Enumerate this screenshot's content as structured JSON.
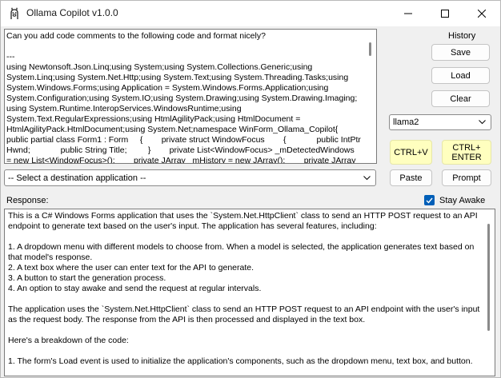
{
  "window": {
    "title": "Ollama Copilot v1.0.0",
    "icon": "llama-icon",
    "controls": {
      "minimize": "minimize-icon",
      "maximize": "maximize-icon",
      "close": "close-icon"
    }
  },
  "prompt": {
    "lines": [
      "Can you add code comments to the following code and format nicely?",
      "",
      "---",
      "using Newtonsoft.Json.Linq;using System;using System.Collections.Generic;using",
      "System.Linq;using System.Net.Http;using System.Text;using System.Threading.Tasks;using",
      "System.Windows.Forms;using Application = System.Windows.Forms.Application;using",
      "System.Configuration;using System.IO;using System.Drawing;using System.Drawing.Imaging;",
      "using System.Runtime.InteropServices.WindowsRuntime;using",
      "System.Text.RegularExpressions;using HtmlAgilityPack;using HtmlDocument =",
      "HtmlAgilityPack.HtmlDocument;using System.Net;namespace WinForm_Ollama_Copilot{",
      "public partial class Form1 : Form     {        private struct WindowFocus        {             public IntPtr",
      "Hwnd;             public String Title;         }        private List<WindowFocus> _mDetectedWindows",
      "= new List<WindowFocus>();        private JArray _mHistory = new JArray();        private JArray"
    ]
  },
  "sidebar": {
    "history_label": "History",
    "save_label": "Save",
    "load_label": "Load",
    "clear_label": "Clear",
    "model_selected": "llama2",
    "ctrl_v_label": "CTRL+V",
    "ctrl_enter_label": "CTRL+\nENTER",
    "paste_label": "Paste",
    "prompt_label": "Prompt"
  },
  "destination": {
    "placeholder": "-- Select a destination application --"
  },
  "response": {
    "label": "Response:",
    "stay_awake_label": "Stay Awake",
    "stay_awake_checked": true,
    "paragraphs": [
      "This is a C# Windows Forms application that uses the `System.Net.HttpClient` class to send an HTTP POST request to an API endpoint to generate text based on the user's input. The application has several features, including:",
      "",
      "1. A dropdown menu with different models to choose from. When a model is selected, the application generates text based on that model's response.",
      "2. A text box where the user can enter text for the API to generate.",
      "3. A button to start the generation process.",
      "4. An option to stay awake and send the request at regular intervals.",
      "",
      "The application uses the `System.Net.HttpClient` class to send an HTTP POST request to an API endpoint with the user's input as the request body. The response from the API is then processed and displayed in the text box.",
      "",
      "Here's a breakdown of the code:",
      "",
      "1. The form's Load event is used to initialize the application's components, such as the dropdown menu, text box, and button."
    ]
  },
  "colors": {
    "window_bg": "#f0f0f0",
    "accent": "#005fb8",
    "yellow_button": "#ffffbf"
  }
}
